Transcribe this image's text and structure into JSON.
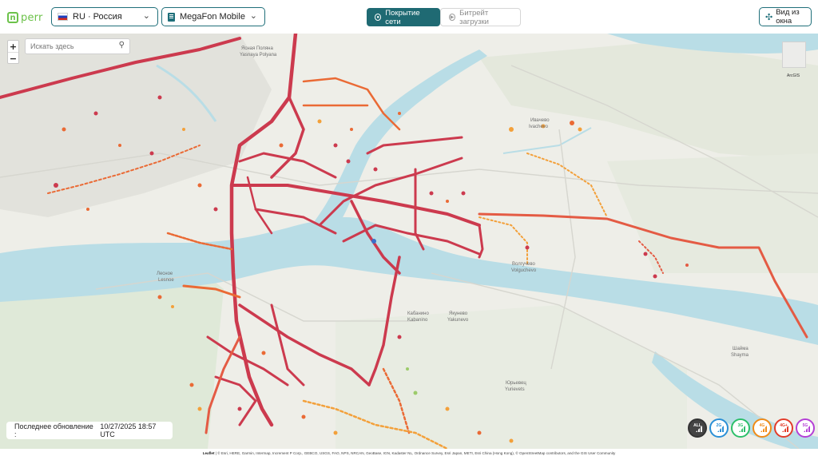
{
  "header": {
    "logo_text": "perr",
    "logo_mark": "n",
    "country_select": {
      "value": "RU · Россия",
      "flag": "ru-flag"
    },
    "operator_select": {
      "value": "MegaFon Mobile"
    },
    "tabs": [
      {
        "label": "Покрытие сети",
        "icon": "signal-icon",
        "active": true
      },
      {
        "label": "Битрейт загрузки",
        "icon": "speed-icon",
        "active": false
      }
    ],
    "window_button": "Вид из окна"
  },
  "map": {
    "search_placeholder": "Искать здесь",
    "zoom_in": "+",
    "zoom_out": "−",
    "arcgis_label": "ArcGIS",
    "last_update_label": "Последнее обновление :",
    "last_update_value": "10/27/2025 18:57 UTC",
    "tech_filters": [
      "ALL",
      "2G",
      "3G",
      "4G",
      "4G+",
      "5G"
    ],
    "place_labels": [
      "Ясная Поляна",
      "Yasnaya Polyana",
      "Лесное",
      "Lesnoe",
      "Волгучево",
      "Volguchevo",
      "Кабанино",
      "Kabanino",
      "Якунево",
      "Yakunevo",
      "Юрьевец",
      "Yurievets",
      "Шайма",
      "Shayma",
      "Ивачево",
      "Ivachevo"
    ],
    "colors": {
      "water": "#b9dde6",
      "coverage_strong": "#cc3a4e",
      "coverage_mid": "#ea6a35",
      "coverage_weak": "#f3a03a"
    }
  },
  "attribution": {
    "brand": "Leaflet",
    "text": "| © Esri, HERE, Garmin, Intermap, Increment P Corp., GEBCO, USGS, FAO, NPS, NRCAN, GeoBase, IGN, Kadaster NL, Ordnance Survey, Esri Japan, METI, Esri China (Hong Kong), © OpenStreetMap contributors, and the GIS User Community"
  }
}
